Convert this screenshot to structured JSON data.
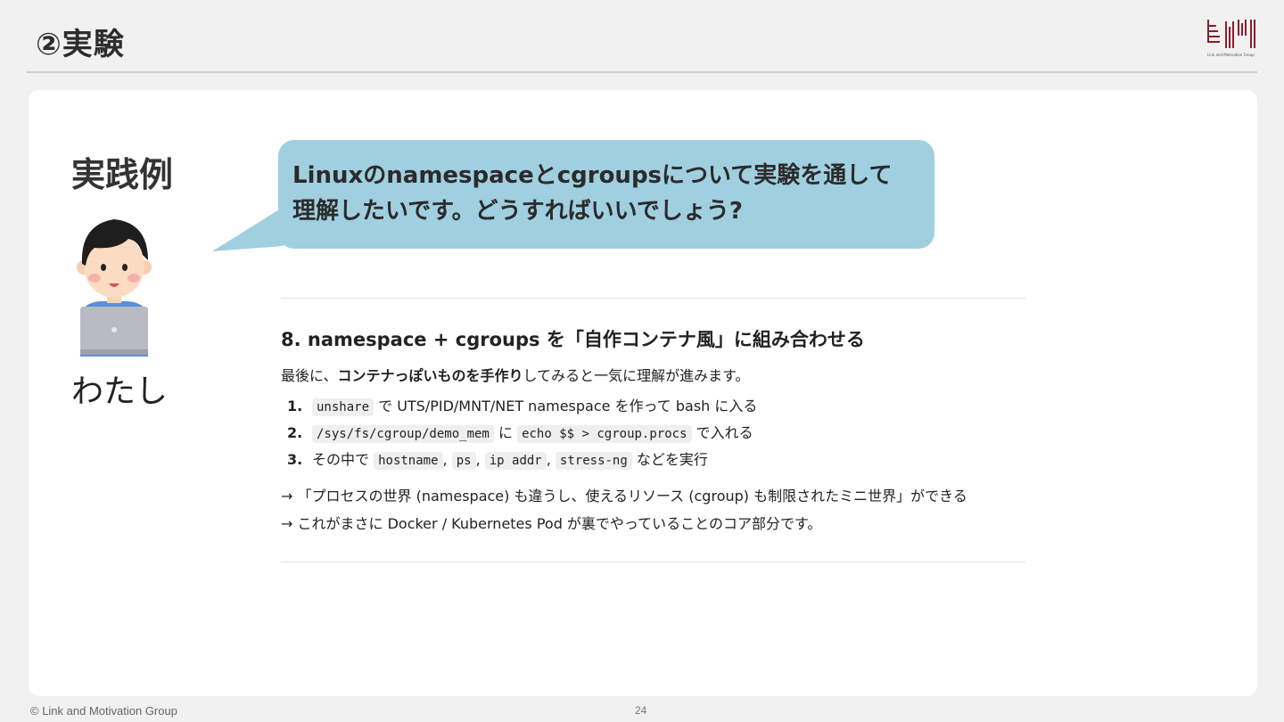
{
  "header": {
    "title": "②実験"
  },
  "logo": {
    "caption": "Link and Motivation Group"
  },
  "aside": {
    "heading": "実践例",
    "person_label": "わたし"
  },
  "bubble": {
    "text": "Linuxのnamespaceとcgroupsについて実験を通して理解したいです。どうすればいいでしょう?"
  },
  "doc": {
    "section_title": "8. namespace + cgroups を「自作コンテナ風」に組み合わせる",
    "intro_prefix": "最後に、",
    "intro_bold": "コンテナっぽいものを手作り",
    "intro_suffix": "してみると一気に理解が進みます。",
    "steps": [
      {
        "num": "1.",
        "code1": "unshare",
        "text1": " で UTS/PID/MNT/NET namespace を作って bash に入る"
      },
      {
        "num": "2.",
        "code1": "/sys/fs/cgroup/demo_mem",
        "text1": " に ",
        "code2": "echo $$ > cgroup.procs",
        "text2": " で入れる"
      },
      {
        "num": "3.",
        "prefix": "その中で ",
        "code1": "hostname",
        "sep1": ", ",
        "code2": "ps",
        "sep2": ", ",
        "code3": "ip addr",
        "sep3": ", ",
        "code4": "stress-ng",
        "suffix": " などを実行"
      }
    ],
    "conclusion_1": "→ 「プロセスの世界 (namespace) も違うし、使えるリソース (cgroup) も制限されたミニ世界」ができる",
    "conclusion_2": "→ これがまさに Docker / Kubernetes Pod が裏でやっていることのコア部分です。"
  },
  "footer": {
    "copyright": "© Link and Motivation Group",
    "page": "24"
  },
  "colors": {
    "bubble": "#a0cfe0",
    "logo_accent": "#8b1e2b",
    "background": "#f1f1f1"
  }
}
